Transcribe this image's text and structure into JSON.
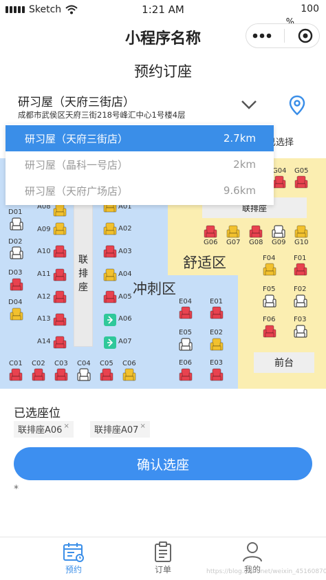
{
  "status": {
    "carrier": "Sketch",
    "time": "1:21 AM",
    "battery": "100",
    "battery_pct": "%"
  },
  "header": {
    "app_title": "小程序名称",
    "page_title": "预约订座"
  },
  "store": {
    "name": "研习屋（天府三街店）",
    "address": "成都市武侯区天府三街218号峰汇中心1号楼4层",
    "behind_text": "已选择"
  },
  "dropdown": [
    {
      "name": "研习屋（天府三街店）",
      "distance": "2.7km"
    },
    {
      "name": "研习屋（晶科一号店）",
      "distance": "2km"
    },
    {
      "name": "研习屋（天府广场店）",
      "distance": "9.6km"
    }
  ],
  "zones": {
    "sprint": "冲刺区",
    "comfort": "舒适区",
    "bench_vertical": [
      "联",
      "排",
      "座"
    ],
    "bench_top": "联排座",
    "front_desk": "前台"
  },
  "seat_labels": {
    "D01": "D01",
    "D02": "D02",
    "D03": "D03",
    "D04": "D04",
    "A08": "A08",
    "A09": "A09",
    "A10": "A10",
    "A11": "A11",
    "A12": "A12",
    "A13": "A13",
    "A14": "A14",
    "A01": "A01",
    "A02": "A02",
    "A03": "A03",
    "A04": "A04",
    "A05": "A05",
    "A06": "A06",
    "A07": "A07",
    "C01": "C01",
    "C02": "C02",
    "C03": "C03",
    "C04": "C04",
    "C05": "C05",
    "C06": "C06",
    "G04": "G04",
    "G05": "G05",
    "G06": "G06",
    "G07": "G07",
    "G08": "G08",
    "G09": "G09",
    "G10": "G10",
    "F01": "F01",
    "F02": "F02",
    "F03": "F03",
    "F04": "F04",
    "F05": "F05",
    "F06": "F06",
    "E01": "E01",
    "E02": "E02",
    "E03": "E03",
    "E04": "E04",
    "E05": "E05",
    "E06": "E06"
  },
  "colors": {
    "occupied": "#e8424f",
    "reserved": "#f2c12e",
    "free": "#ffffff",
    "selected": "#2fc89a",
    "accent": "#3a8ee8"
  },
  "selected": {
    "title": "已选座位",
    "chips": [
      "联排座A06",
      "联排座A07"
    ],
    "chip_close": "×",
    "confirm_label": "确认选座",
    "note": "*"
  },
  "tabs": [
    {
      "label": "预约",
      "icon": "calendar-icon"
    },
    {
      "label": "订单",
      "icon": "clipboard-icon"
    },
    {
      "label": "我的",
      "icon": "user-icon"
    }
  ],
  "watermark": "https://blog.csdn.net/weixin_45160870"
}
